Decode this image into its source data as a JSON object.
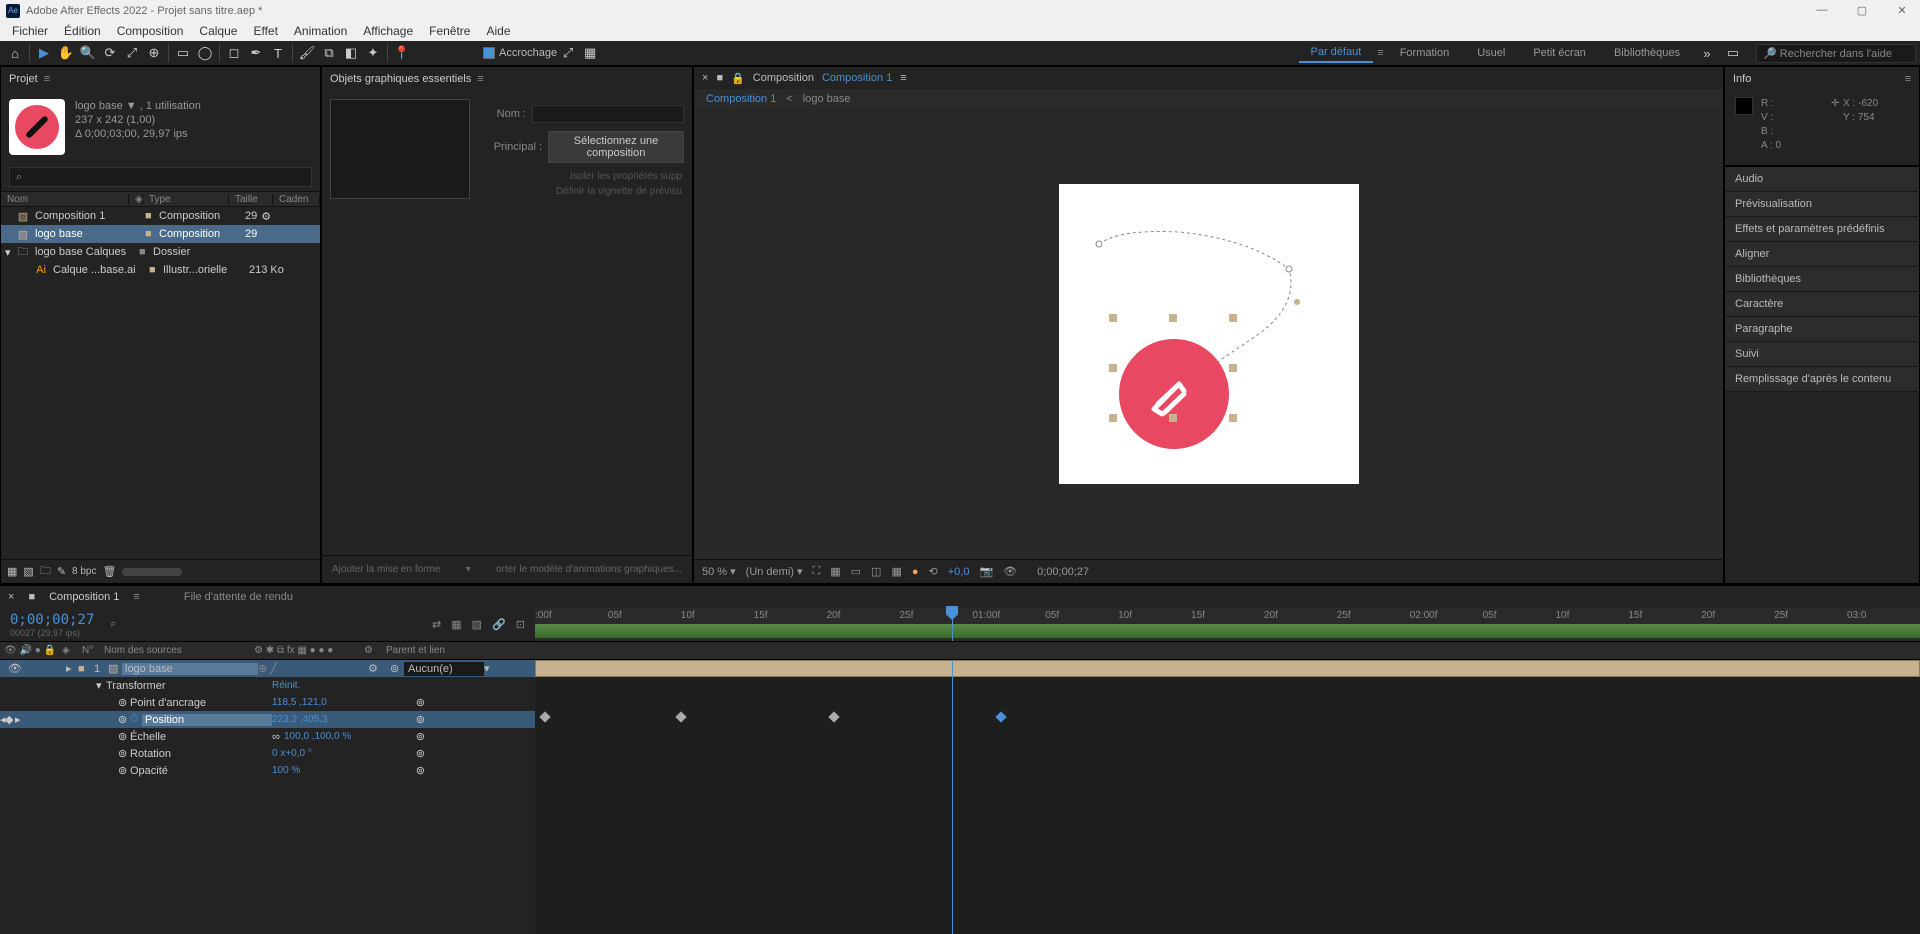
{
  "app": {
    "title": "Adobe After Effects 2022 - Projet sans titre.aep *",
    "icon": "Ae"
  },
  "menu": [
    "Fichier",
    "Édition",
    "Composition",
    "Calque",
    "Effet",
    "Animation",
    "Affichage",
    "Fenêtre",
    "Aide"
  ],
  "toolbar": {
    "snap_label": "Accrochage",
    "workspaces": [
      {
        "label": "Par défaut",
        "active": true
      },
      {
        "label": "Formation",
        "active": false
      },
      {
        "label": "Usuel",
        "active": false
      },
      {
        "label": "Petit écran",
        "active": false
      },
      {
        "label": "Bibliothèques",
        "active": false
      }
    ],
    "search_placeholder": "Rechercher dans l'aide"
  },
  "project": {
    "title": "Projet",
    "asset_name": "logo base ▼",
    "asset_meta1": ", 1 utilisation",
    "asset_meta2": "237 x 242 (1,00)",
    "asset_meta3": "Δ 0;00;03;00, 29,97 ips",
    "columns": {
      "name": "Nom",
      "type": "Type",
      "size": "Taille",
      "cadence": "Caden"
    },
    "rows": [
      {
        "icon": "comp",
        "name": "Composition 1",
        "type": "Composition",
        "size": "29",
        "selected": false,
        "indent": 0,
        "arrow": ""
      },
      {
        "icon": "comp",
        "name": "logo base",
        "type": "Composition",
        "size": "29",
        "selected": true,
        "indent": 0,
        "arrow": ""
      },
      {
        "icon": "folder",
        "name": "logo base Calques",
        "type": "Dossier",
        "size": "",
        "selected": false,
        "indent": 0,
        "arrow": "▾"
      },
      {
        "icon": "ai",
        "name": "Calque ...base.ai",
        "type": "Illustr...orielle",
        "size": "213 Ko",
        "selected": false,
        "indent": 1,
        "arrow": ""
      }
    ],
    "bpc": "8 bpc"
  },
  "eg": {
    "title": "Objets graphiques essentiels",
    "name_label": "Nom :",
    "principal_label": "Principal :",
    "principal_value": "Sélectionnez une composition",
    "disabled1": "Isoler les propriétés supp",
    "disabled2": "Définir la vignette de prévisu",
    "footer_left": "Ajouter la mise en forme",
    "footer_right": "orter le modèle d'animations graphiques..."
  },
  "comp": {
    "title": "Composition",
    "active_tab": "Composition 1",
    "breadcrumb1": "Composition 1",
    "breadcrumb2": "logo base",
    "zoom": "50 %",
    "resolution": "(Un demi)",
    "exposure": "+0,0",
    "timecode": "0;00;00;27"
  },
  "info": {
    "title": "Info",
    "r": "R :",
    "v": "V :",
    "b": "B :",
    "a": "A :",
    "a_val": "0",
    "x": "X : -620",
    "y": "Y : 754"
  },
  "right_panels": [
    "Audio",
    "Prévisualisation",
    "Effets et paramètres prédéfinis",
    "Aligner",
    "Bibliothèques",
    "Caractère",
    "Paragraphe",
    "Suivi",
    "Remplissage d'après le contenu"
  ],
  "timeline": {
    "tab1": "Composition 1",
    "tab2": "File d'attente de rendu",
    "timecode": "0;00;00;27",
    "frame_info": "00027 (29,97 ips)",
    "ruler": [
      ":00f",
      "05f",
      "10f",
      "15f",
      "20f",
      "25f",
      "01:00f",
      "05f",
      "10f",
      "15f",
      "20f",
      "25f",
      "02:00f",
      "05f",
      "10f",
      "15f",
      "20f",
      "25f",
      "03:0"
    ],
    "col_num": "N°",
    "col_source": "Nom des sources",
    "col_parent": "Parent et lien",
    "layer1_num": "1",
    "layer1_name": "logo base",
    "layer1_parent": "Aucun(e)",
    "transform": "Transformer",
    "reset": "Réinit.",
    "props": [
      {
        "name": "Point d'ancrage",
        "val": "118,5 ,121,0",
        "sel": false
      },
      {
        "name": "Position",
        "val": "223,2 ,405,3",
        "sel": true
      },
      {
        "name": "Échelle",
        "val": "100,0 ,100,0 %",
        "sel": false
      },
      {
        "name": "Rotation",
        "val": "0 x+0,0 °",
        "sel": false
      },
      {
        "name": "Opacité",
        "val": "100 %",
        "sel": false
      }
    ]
  }
}
